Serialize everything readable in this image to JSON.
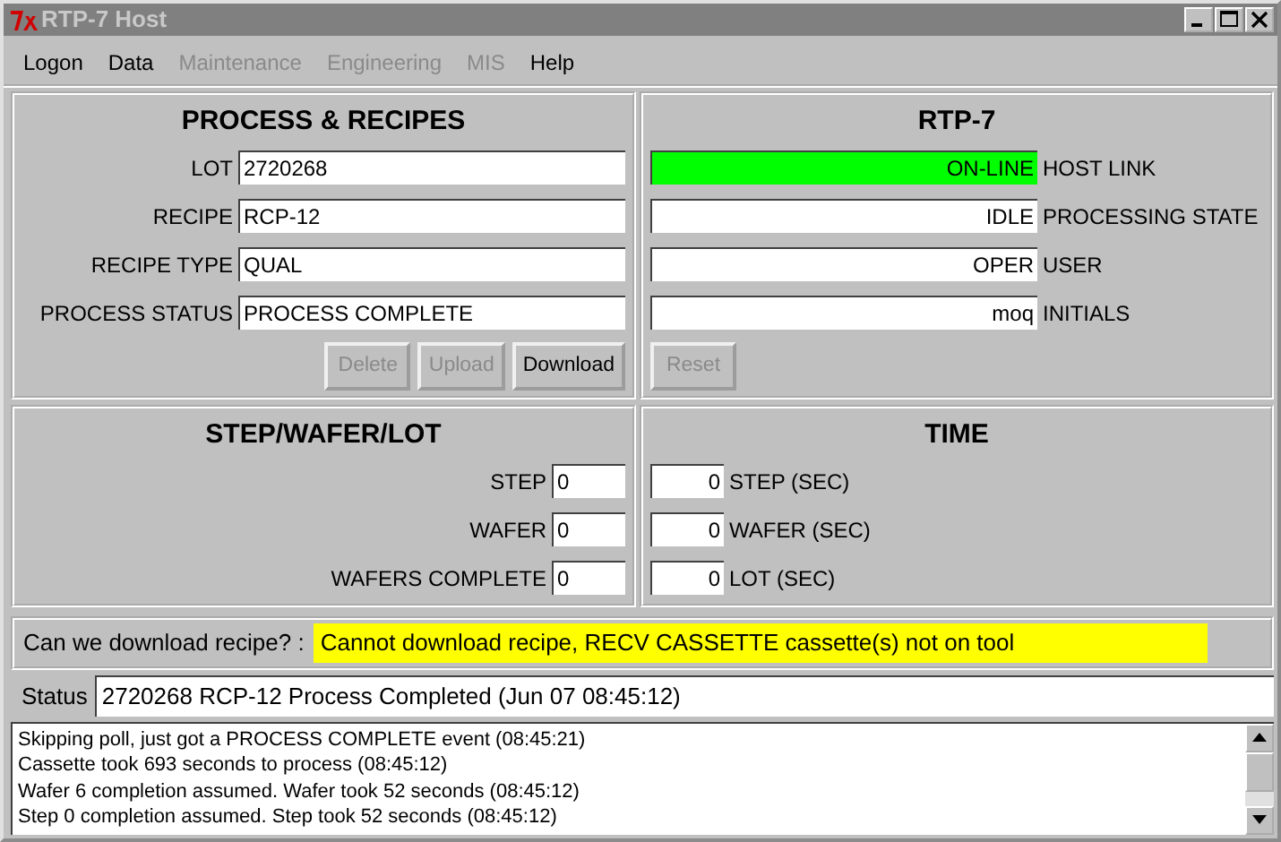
{
  "window": {
    "title": "RTP-7 Host"
  },
  "menu": [
    {
      "label": "Logon",
      "disabled": false
    },
    {
      "label": "Data",
      "disabled": false
    },
    {
      "label": "Maintenance",
      "disabled": true
    },
    {
      "label": "Engineering",
      "disabled": true
    },
    {
      "label": "MIS",
      "disabled": true
    },
    {
      "label": "Help",
      "disabled": false
    }
  ],
  "process_panel": {
    "title": "PROCESS & RECIPES",
    "fields": [
      {
        "label": "LOT",
        "value": "2720268"
      },
      {
        "label": "RECIPE",
        "value": "RCP-12"
      },
      {
        "label": "RECIPE TYPE",
        "value": "QUAL"
      },
      {
        "label": "PROCESS STATUS",
        "value": "PROCESS COMPLETE"
      }
    ],
    "buttons": [
      {
        "label": "Delete",
        "disabled": true
      },
      {
        "label": "Upload",
        "disabled": true
      },
      {
        "label": "Download",
        "disabled": false
      }
    ]
  },
  "tool_panel": {
    "title": "RTP-7",
    "fields": [
      {
        "value": "ON-LINE",
        "label": "HOST LINK",
        "color": "#00ff00"
      },
      {
        "value": "IDLE",
        "label": "PROCESSING STATE",
        "color": "#ffffff"
      },
      {
        "value": "OPER",
        "label": "USER",
        "color": "#ffffff"
      },
      {
        "value": "moq",
        "label": "INITIALS",
        "color": "#ffffff"
      }
    ],
    "buttons": [
      {
        "label": "Reset",
        "disabled": true
      }
    ]
  },
  "count_panel": {
    "title": "STEP/WAFER/LOT",
    "fields": [
      {
        "label": "STEP",
        "value": "0"
      },
      {
        "label": "WAFER",
        "value": "0"
      },
      {
        "label": "WAFERS COMPLETE",
        "value": "0"
      }
    ]
  },
  "time_panel": {
    "title": "TIME",
    "fields": [
      {
        "value": "0",
        "label": "STEP (SEC)"
      },
      {
        "value": "0",
        "label": "WAFER (SEC)"
      },
      {
        "value": "0",
        "label": "LOT (SEC)"
      }
    ]
  },
  "download_check": {
    "label": "Can we download recipe? :",
    "answer": "Cannot download recipe, RECV CASSETTE cassette(s) not on tool"
  },
  "status": {
    "label": "Status",
    "value": "2720268 RCP-12 Process Completed (Jun 07 08:45:12)"
  },
  "log": [
    "Skipping poll, just got a PROCESS COMPLETE event (08:45:21)",
    "Cassette took 693 seconds to process (08:45:12)",
    "Wafer 6 completion assumed. Wafer took 52 seconds (08:45:12)",
    "Step 0 completion assumed. Step took 52 seconds (08:45:12)"
  ]
}
